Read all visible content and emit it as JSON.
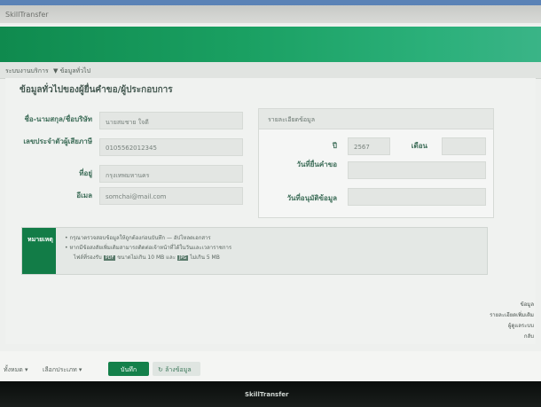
{
  "window": {
    "title": "SkillTransfer"
  },
  "subnav": {
    "left": "ระบบงานบริการ",
    "right": "▼ ข้อมูลทั่วไป"
  },
  "section": {
    "title": "ข้อมูลทั่วไปของผู้ยื่นคำขอ/ผู้ประกอบการ"
  },
  "form": {
    "fields": [
      {
        "label": "ชื่อ-นามสกุล/ชื่อบริษัท",
        "value": "นายสมชาย ใจดี"
      },
      {
        "label": "เลขประจำตัวผู้เสียภาษี",
        "value": "0105562012345"
      },
      {
        "label": "ที่อยู่",
        "value": "กรุงเทพมหานคร"
      },
      {
        "label": "อีเมล",
        "value": "somchai@mail.com"
      }
    ]
  },
  "box": {
    "header": "รายละเอียดข้อมูล",
    "row1_label": "ปี",
    "row1_value": "2567",
    "row1_label2": "เดือน",
    "row2_label": "วันที่ยื่นคำขอ",
    "row3_label": "วันที่อนุมัติข้อมูล"
  },
  "note": {
    "tag": "หมายเหตุ",
    "line1": "• กรุณาตรวจสอบข้อมูลให้ถูกต้องก่อนบันทึก — อัปโหลดเอกสาร",
    "line2": "• หากมีข้อสงสัยเพิ่มเติมสามารถติดต่อเจ้าหน้าที่ได้ในวันและเวลาราชการ",
    "line3_a": "ไฟล์ที่รองรับ",
    "chip1": "PDF",
    "line3_b": "ขนาดไม่เกิน 10 MB และ",
    "chip2": "JPG",
    "line3_c": "ไม่เกิน 5 MB"
  },
  "side": {
    "a": "ข้อมูล",
    "b": "รายละเอียดเพิ่มเติม",
    "c": "ผู้ดูแลระบบ",
    "d": "กลับ"
  },
  "bottom": {
    "select1": "ทั้งหมด ▾",
    "select2": "เลือกประเภท ▾",
    "save": "บันทึก",
    "cancel": "↻ ล้างข้อมูล"
  },
  "footer": {
    "text": "SkillTransfer"
  }
}
